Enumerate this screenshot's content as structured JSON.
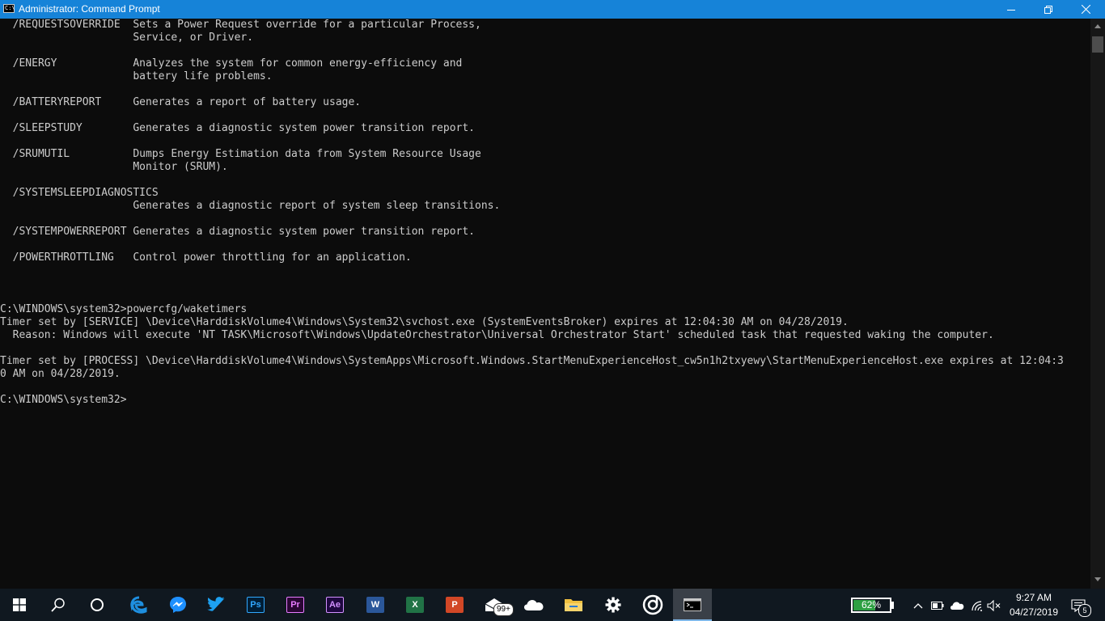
{
  "window": {
    "title": "Administrator: Command Prompt",
    "icon_label": "C:\\",
    "controls": [
      "minimize-icon",
      "maximize-icon",
      "close-icon"
    ]
  },
  "console": {
    "lines": [
      "  /REQUESTSOVERRIDE  Sets a Power Request override for a particular Process,",
      "                     Service, or Driver.",
      "",
      "  /ENERGY            Analyzes the system for common energy-efficiency and",
      "                     battery life problems.",
      "",
      "  /BATTERYREPORT     Generates a report of battery usage.",
      "",
      "  /SLEEPSTUDY        Generates a diagnostic system power transition report.",
      "",
      "  /SRUMUTIL          Dumps Energy Estimation data from System Resource Usage",
      "                     Monitor (SRUM).",
      "",
      "  /SYSTEMSLEEPDIAGNOSTICS",
      "                     Generates a diagnostic report of system sleep transitions.",
      "",
      "  /SYSTEMPOWERREPORT Generates a diagnostic system power transition report.",
      "",
      "  /POWERTHROTTLING   Control power throttling for an application.",
      "",
      "",
      "",
      "C:\\WINDOWS\\system32>powercfg/waketimers",
      "Timer set by [SERVICE] \\Device\\HarddiskVolume4\\Windows\\System32\\svchost.exe (SystemEventsBroker) expires at 12:04:30 AM on 04/28/2019.",
      "  Reason: Windows will execute 'NT TASK\\Microsoft\\Windows\\UpdateOrchestrator\\Universal Orchestrator Start' scheduled task that requested waking the computer.",
      "",
      "Timer set by [PROCESS] \\Device\\HarddiskVolume4\\Windows\\SystemApps\\Microsoft.Windows.StartMenuExperienceHost_cw5n1h2txyewy\\StartMenuExperienceHost.exe expires at 12:04:3",
      "0 AM on 04/28/2019.",
      "",
      "C:\\WINDOWS\\system32>"
    ]
  },
  "taskbar": {
    "items": [
      {
        "icon": "windows-start-icon"
      },
      {
        "icon": "search-icon"
      },
      {
        "icon": "cortana-icon"
      },
      {
        "icon": "edge-icon"
      },
      {
        "icon": "messenger-icon"
      },
      {
        "icon": "twitter-icon"
      },
      {
        "icon": "photoshop-icon",
        "label": "Ps",
        "color": "#31a8ff",
        "bg": "#001e36"
      },
      {
        "icon": "premiere-icon",
        "label": "Pr",
        "color": "#e77bff",
        "bg": "#2a0634"
      },
      {
        "icon": "after-effects-icon",
        "label": "Ae",
        "color": "#d291ff",
        "bg": "#1f0740"
      },
      {
        "icon": "word-icon",
        "label": "W",
        "color": "#ffffff",
        "bg": "#2b579a"
      },
      {
        "icon": "excel-icon",
        "label": "X",
        "color": "#ffffff",
        "bg": "#217346"
      },
      {
        "icon": "powerpoint-icon",
        "label": "P",
        "color": "#ffffff",
        "bg": "#d24726"
      },
      {
        "icon": "mail-icon",
        "badge": "99+"
      },
      {
        "icon": "onedrive-icon"
      },
      {
        "icon": "file-explorer-icon"
      },
      {
        "icon": "settings-gear-icon"
      },
      {
        "icon": "groove-music-icon"
      },
      {
        "icon": "command-prompt-icon",
        "active": true
      }
    ],
    "battery_percent": "62%",
    "battery_level": 0.62,
    "clock_time": "9:27 AM",
    "clock_date": "04/27/2019",
    "notification_count": "5"
  }
}
